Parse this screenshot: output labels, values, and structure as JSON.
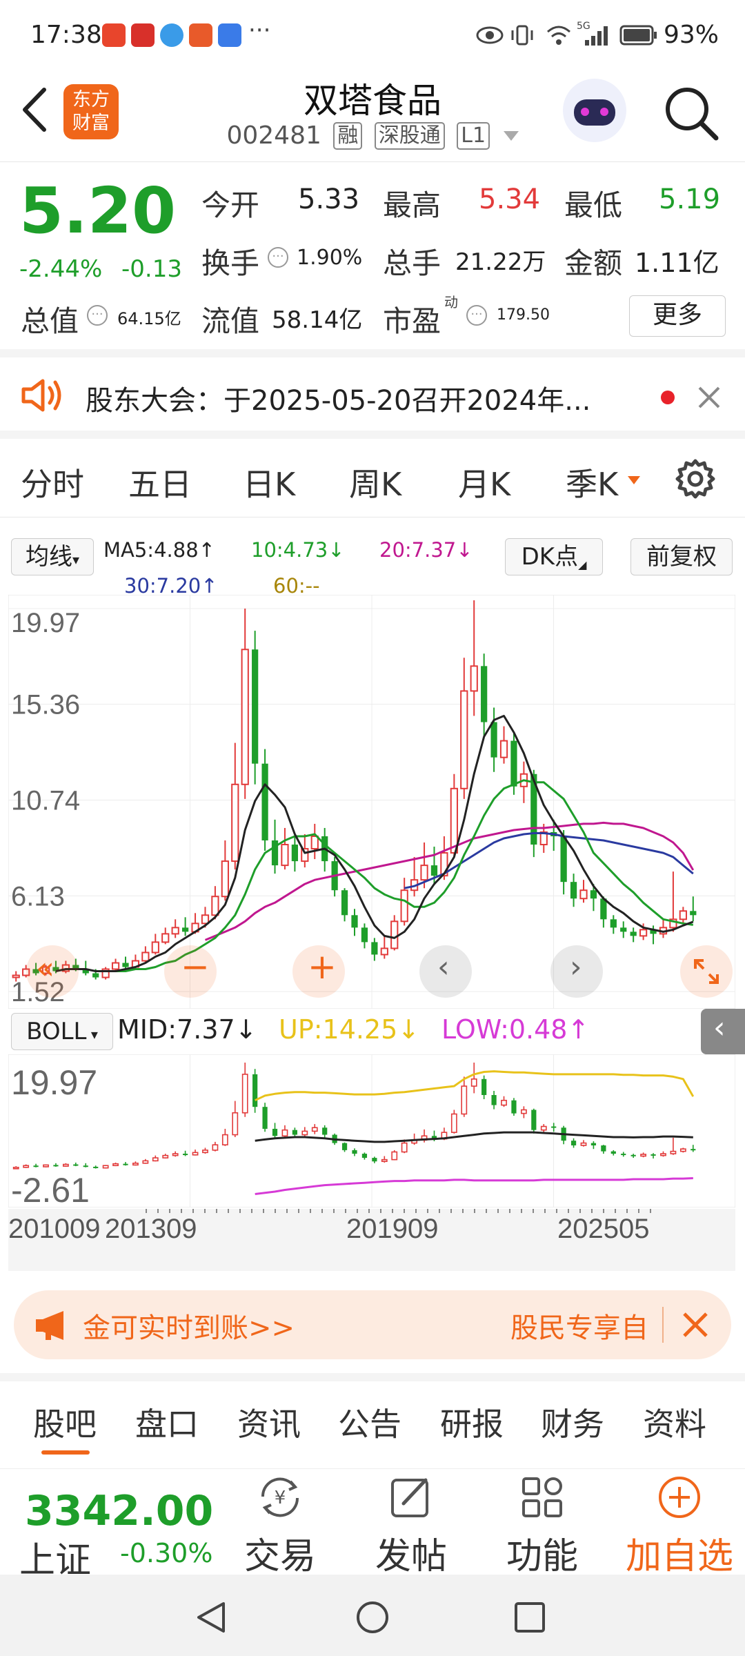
{
  "status_bar": {
    "time": "17:38",
    "battery": "93%",
    "net": "5G"
  },
  "header": {
    "back": "<",
    "logo_line1": "东方",
    "logo_line2": "财富",
    "name": "双塔食品",
    "code": "002481",
    "tag_margin": "融",
    "tag_connect": "深股通",
    "tag_level": "L1"
  },
  "quote": {
    "price": "5.20",
    "change_pct": "-2.44%",
    "change": "-0.13",
    "open_label": "今开",
    "open": "5.33",
    "high_label": "最高",
    "high": "5.34",
    "low_label": "最低",
    "low": "5.19",
    "turnover_label": "换手",
    "turnover": "1.90%",
    "volume_label": "总手",
    "volume": "21.22万",
    "amount_label": "金额",
    "amount": "1.11亿",
    "mktcap_label": "总值",
    "mktcap": "64.15亿",
    "float_label": "流值",
    "float_cap": "58.14亿",
    "pe_label": "市盈",
    "pe_sup": "动",
    "pe": "179.50",
    "more_button": "更多"
  },
  "notice": {
    "text": "股东大会：于2025-05-20召开2024年..."
  },
  "period_tabs": [
    "分时",
    "五日",
    "日K",
    "周K",
    "月K",
    "季K"
  ],
  "active_tab": "季K",
  "ma": {
    "selector": "均线",
    "ma5": "MA5:4.88↑",
    "ma10": "10:4.73↓",
    "ma20": "20:7.37↓",
    "ma30": "30:7.20↑",
    "ma60": "60:--",
    "dk_button": "DK点",
    "adjust_button": "前复权"
  },
  "main_axis": [
    "19.97",
    "15.36",
    "10.74",
    "6.13",
    "1.52"
  ],
  "boll": {
    "selector": "BOLL",
    "mid": "MID:7.37↓",
    "up": "UP:14.25↓",
    "low": "LOW:0.48↑"
  },
  "sub_axis": [
    "19.97",
    "-2.61"
  ],
  "date_axis": [
    "201009",
    "201309",
    "201909",
    "202505"
  ],
  "colors": {
    "up": "#e23a3a",
    "down": "#1e9e2a",
    "accent": "#f0661a",
    "ma5": "#222222",
    "ma10": "#1e9e2a",
    "ma20": "#c0178f",
    "ma30": "#2a3aa0",
    "boll_up": "#e8c21a",
    "boll_low": "#d63ad6"
  },
  "chart_data": {
    "type": "candlestick",
    "period": "季K",
    "candles": [
      [
        2.2,
        2.3,
        2.0,
        2.5
      ],
      [
        2.3,
        2.6,
        2.2,
        2.8
      ],
      [
        2.6,
        2.4,
        2.3,
        2.9
      ],
      [
        2.4,
        2.7,
        2.3,
        2.8
      ],
      [
        2.7,
        2.5,
        2.4,
        3.0
      ],
      [
        2.5,
        2.8,
        2.4,
        3.0
      ],
      [
        2.8,
        2.6,
        2.5,
        3.1
      ],
      [
        2.6,
        2.4,
        2.3,
        3.0
      ],
      [
        2.4,
        2.2,
        2.1,
        2.6
      ],
      [
        2.2,
        2.6,
        2.1,
        2.7
      ],
      [
        2.6,
        2.9,
        2.5,
        3.1
      ],
      [
        2.9,
        2.7,
        2.6,
        3.2
      ],
      [
        2.7,
        3.0,
        2.6,
        3.3
      ],
      [
        3.0,
        3.4,
        2.9,
        3.7
      ],
      [
        3.4,
        3.9,
        3.3,
        4.3
      ],
      [
        3.9,
        4.3,
        3.8,
        4.6
      ],
      [
        4.3,
        4.6,
        4.1,
        5.0
      ],
      [
        4.6,
        4.4,
        4.2,
        5.1
      ],
      [
        4.4,
        4.8,
        4.3,
        5.3
      ],
      [
        4.8,
        5.2,
        4.6,
        5.6
      ],
      [
        5.2,
        6.1,
        5.0,
        6.6
      ],
      [
        6.1,
        7.8,
        5.9,
        8.8
      ],
      [
        7.8,
        11.5,
        7.4,
        13.5
      ],
      [
        11.5,
        18.0,
        10.8,
        19.97
      ],
      [
        18.0,
        12.5,
        11.5,
        18.9
      ],
      [
        12.5,
        8.8,
        8.3,
        13.2
      ],
      [
        8.8,
        7.6,
        7.2,
        9.8
      ],
      [
        7.6,
        8.6,
        7.4,
        9.4
      ],
      [
        8.6,
        7.8,
        7.3,
        9.0
      ],
      [
        7.8,
        8.4,
        7.5,
        9.1
      ],
      [
        8.4,
        9.0,
        7.9,
        9.6
      ],
      [
        9.0,
        7.8,
        7.3,
        9.4
      ],
      [
        7.8,
        6.4,
        6.1,
        8.0
      ],
      [
        6.4,
        5.2,
        4.9,
        6.5
      ],
      [
        5.2,
        4.6,
        4.2,
        5.5
      ],
      [
        4.6,
        3.9,
        3.6,
        4.8
      ],
      [
        3.9,
        3.3,
        3.0,
        4.1
      ],
      [
        3.3,
        3.6,
        3.1,
        4.2
      ],
      [
        3.6,
        4.9,
        3.5,
        5.2
      ],
      [
        4.9,
        6.4,
        4.7,
        7.0
      ],
      [
        6.4,
        6.9,
        6.1,
        8.0
      ],
      [
        6.9,
        7.6,
        6.5,
        8.7
      ],
      [
        7.6,
        7.1,
        6.7,
        8.5
      ],
      [
        7.1,
        8.2,
        6.9,
        9.0
      ],
      [
        8.2,
        11.3,
        8.0,
        12.0
      ],
      [
        11.3,
        16.0,
        10.8,
        17.6
      ],
      [
        16.0,
        17.2,
        14.8,
        20.5
      ],
      [
        17.2,
        14.5,
        13.8,
        17.8
      ],
      [
        14.5,
        12.8,
        12.1,
        15.2
      ],
      [
        12.8,
        13.6,
        12.5,
        14.3
      ],
      [
        13.6,
        11.4,
        11.0,
        14.0
      ],
      [
        11.4,
        12.0,
        10.6,
        12.6
      ],
      [
        12.0,
        8.6,
        8.0,
        12.2
      ],
      [
        8.6,
        9.2,
        8.2,
        9.6
      ],
      [
        9.2,
        9.0,
        8.3,
        9.8
      ],
      [
        9.0,
        6.8,
        6.2,
        9.3
      ],
      [
        6.8,
        6.0,
        5.6,
        7.2
      ],
      [
        6.0,
        6.4,
        5.8,
        6.9
      ],
      [
        6.4,
        6.0,
        5.4,
        6.7
      ],
      [
        6.0,
        5.0,
        4.6,
        6.1
      ],
      [
        5.0,
        4.6,
        4.3,
        5.2
      ],
      [
        4.6,
        4.4,
        4.1,
        4.9
      ],
      [
        4.4,
        4.2,
        3.9,
        4.6
      ],
      [
        4.2,
        4.5,
        4.0,
        4.8
      ],
      [
        4.5,
        4.3,
        3.8,
        4.7
      ],
      [
        4.3,
        4.6,
        4.1,
        5.0
      ],
      [
        4.6,
        5.0,
        4.4,
        7.3
      ],
      [
        5.0,
        5.4,
        4.8,
        5.6
      ],
      [
        5.4,
        5.2,
        4.9,
        6.1
      ]
    ],
    "ma5": [
      null,
      null,
      null,
      null,
      2.5,
      2.6,
      2.6,
      2.6,
      2.5,
      2.5,
      2.5,
      2.6,
      2.7,
      2.9,
      3.2,
      3.4,
      3.8,
      4.1,
      4.4,
      4.7,
      5.1,
      5.7,
      7.0,
      9.3,
      10.7,
      11.5,
      11.0,
      10.4,
      9.1,
      8.2,
      8.3,
      8.4,
      8.1,
      7.4,
      6.6,
      5.6,
      4.7,
      4.2,
      4.1,
      4.4,
      5.0,
      6.0,
      6.7,
      7.2,
      8.0,
      9.8,
      12.0,
      13.8,
      14.6,
      14.8,
      14.0,
      13.0,
      11.7,
      10.5,
      9.7,
      9.0,
      8.3,
      7.4,
      6.6,
      6.0,
      5.6,
      5.3,
      4.9,
      4.6,
      4.5,
      4.4,
      4.5,
      4.7,
      4.88
    ],
    "ma10": [
      null,
      null,
      null,
      null,
      null,
      null,
      null,
      null,
      null,
      2.5,
      2.5,
      2.5,
      2.6,
      2.6,
      2.7,
      2.9,
      3.0,
      3.3,
      3.5,
      3.8,
      4.1,
      4.6,
      5.2,
      6.2,
      7.4,
      8.2,
      8.5,
      8.8,
      9.0,
      9.0,
      9.1,
      8.6,
      8.2,
      7.8,
      7.4,
      7.0,
      6.5,
      6.2,
      6.0,
      5.9,
      5.6,
      5.6,
      5.8,
      6.3,
      7.0,
      8.1,
      9.0,
      10.0,
      10.8,
      11.3,
      11.5,
      11.7,
      11.6,
      11.6,
      11.2,
      10.8,
      10.0,
      9.2,
      8.2,
      7.7,
      7.2,
      6.7,
      6.3,
      5.8,
      5.4,
      5.0,
      4.9,
      4.8,
      4.73
    ],
    "ma20": [
      null,
      null,
      null,
      null,
      null,
      null,
      null,
      null,
      null,
      null,
      null,
      null,
      null,
      null,
      null,
      null,
      null,
      null,
      null,
      4.0,
      4.2,
      4.4,
      4.6,
      4.9,
      5.3,
      5.6,
      5.8,
      6.1,
      6.4,
      6.7,
      6.9,
      7.0,
      7.1,
      7.2,
      7.3,
      7.4,
      7.5,
      7.6,
      7.7,
      7.8,
      7.9,
      8.0,
      8.1,
      8.3,
      8.5,
      8.7,
      8.9,
      9.0,
      9.1,
      9.2,
      9.3,
      9.35,
      9.4,
      9.4,
      9.45,
      9.5,
      9.55,
      9.6,
      9.6,
      9.65,
      9.6,
      9.6,
      9.5,
      9.4,
      9.2,
      9.0,
      8.7,
      8.2,
      7.37
    ],
    "ma30": [
      null,
      null,
      null,
      null,
      null,
      null,
      null,
      null,
      null,
      null,
      null,
      null,
      null,
      null,
      null,
      null,
      null,
      null,
      null,
      null,
      null,
      null,
      null,
      null,
      null,
      null,
      null,
      null,
      null,
      null,
      null,
      null,
      null,
      null,
      null,
      null,
      null,
      null,
      null,
      6.5,
      6.6,
      6.8,
      7.0,
      7.2,
      7.5,
      7.8,
      8.1,
      8.4,
      8.7,
      8.9,
      9.0,
      9.1,
      9.15,
      9.15,
      9.1,
      9.0,
      8.95,
      8.9,
      8.85,
      8.8,
      8.7,
      8.6,
      8.5,
      8.4,
      8.3,
      8.2,
      8.0,
      7.6,
      7.2
    ],
    "boll_mid": [
      null,
      null,
      null,
      null,
      null,
      null,
      null,
      null,
      null,
      null,
      null,
      null,
      null,
      null,
      null,
      null,
      null,
      null,
      null,
      null,
      null,
      null,
      null,
      null,
      6.8,
      7.0,
      7.2,
      7.3,
      7.4,
      7.4,
      7.3,
      7.2,
      7.0,
      6.9,
      6.8,
      6.7,
      6.6,
      6.6,
      6.7,
      6.8,
      6.9,
      7.0,
      7.1,
      7.2,
      7.4,
      7.6,
      7.8,
      8.0,
      8.1,
      8.2,
      8.2,
      8.2,
      8.2,
      8.1,
      8.0,
      7.9,
      7.8,
      7.7,
      7.6,
      7.5,
      7.4,
      7.4,
      7.35,
      7.4,
      7.4,
      7.5,
      7.5,
      7.45,
      7.37
    ],
    "boll_up": [
      null,
      null,
      null,
      null,
      null,
      null,
      null,
      null,
      null,
      null,
      null,
      null,
      null,
      null,
      null,
      null,
      null,
      null,
      null,
      null,
      null,
      null,
      null,
      null,
      13.6,
      14.4,
      14.7,
      14.9,
      15.0,
      15.0,
      14.9,
      14.9,
      14.8,
      14.7,
      14.6,
      14.6,
      14.6,
      14.7,
      14.9,
      15.0,
      15.2,
      15.4,
      15.6,
      15.8,
      16.0,
      17.2,
      18.0,
      18.4,
      18.5,
      18.4,
      18.3,
      18.3,
      18.2,
      18.1,
      18.0,
      18.0,
      18.0,
      18.0,
      18.0,
      18.0,
      18.0,
      17.9,
      17.9,
      17.8,
      17.8,
      17.8,
      17.6,
      17.2,
      14.25
    ],
    "boll_low": [
      null,
      null,
      null,
      null,
      null,
      null,
      null,
      null,
      null,
      null,
      null,
      null,
      null,
      null,
      null,
      null,
      null,
      null,
      null,
      null,
      null,
      null,
      null,
      null,
      -2.2,
      -2.0,
      -1.8,
      -1.5,
      -1.3,
      -1.1,
      -0.9,
      -0.7,
      -0.6,
      -0.5,
      -0.4,
      -0.3,
      -0.2,
      -0.1,
      0.0,
      0.0,
      0.1,
      0.1,
      0.1,
      0.1,
      0.2,
      0.2,
      0.1,
      0.1,
      0.1,
      0.1,
      0.1,
      0.1,
      0.1,
      0.2,
      0.2,
      0.2,
      0.2,
      0.2,
      0.2,
      0.2,
      0.2,
      0.2,
      0.3,
      0.3,
      0.3,
      0.3,
      0.4,
      0.4,
      0.48
    ],
    "y_range": [
      1.52,
      19.97
    ],
    "sub_y_range": [
      -2.61,
      19.97
    ]
  },
  "promo": {
    "text_left": "金可实时到账>>",
    "text_right": "股民专享自"
  },
  "bottom_tabs": [
    "股吧",
    "盘口",
    "资讯",
    "公告",
    "研报",
    "财务",
    "资料"
  ],
  "active_bottom_tab": "股吧",
  "index": {
    "value": "3342.00",
    "name": "上证",
    "change": "-0.30%"
  },
  "bottom_bar": {
    "trade": "交易",
    "post": "发帖",
    "functions": "功能",
    "add_watch": "加自选"
  }
}
